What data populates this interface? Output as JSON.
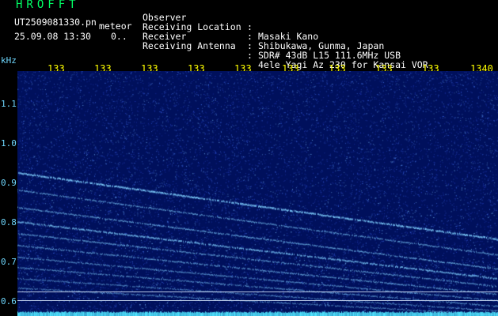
{
  "header": {
    "title": "HROFFT",
    "filename": "UT2509081330.pn",
    "mode": "meteor",
    "datetime": "25.09.08 13:30",
    "counter": "0.."
  },
  "info": [
    {
      "label": "Observer",
      "value": "Masaki Kano"
    },
    {
      "label": "Receiving Location",
      "value": "Shibukawa, Gunma, Japan"
    },
    {
      "label": "Receiver",
      "value": "SDR# 43dB L15 111.6MHz USB"
    },
    {
      "label": "Receiving Antenna",
      "value": "4ele Yagi Az 230 for Kansai VOR"
    }
  ],
  "axis": {
    "y_unit": "kHz",
    "y_ticks": [
      {
        "label": "1.1",
        "value": 1.1
      },
      {
        "label": "1.0",
        "value": 1.0
      },
      {
        "label": "0.9",
        "value": 0.9
      },
      {
        "label": "0.8",
        "value": 0.8
      },
      {
        "label": "0.7",
        "value": 0.7
      },
      {
        "label": "0.6",
        "value": 0.6
      }
    ],
    "x_ticks": [
      "133",
      "133",
      "133",
      "133",
      "133",
      "133",
      "133",
      "133",
      "133",
      "1340"
    ]
  },
  "colors": {
    "background": "#00105c",
    "trace": "#7fd0ff",
    "title": "#00ff66",
    "axis_x": "#ffff00",
    "axis_y": "#6fd8ff"
  }
}
